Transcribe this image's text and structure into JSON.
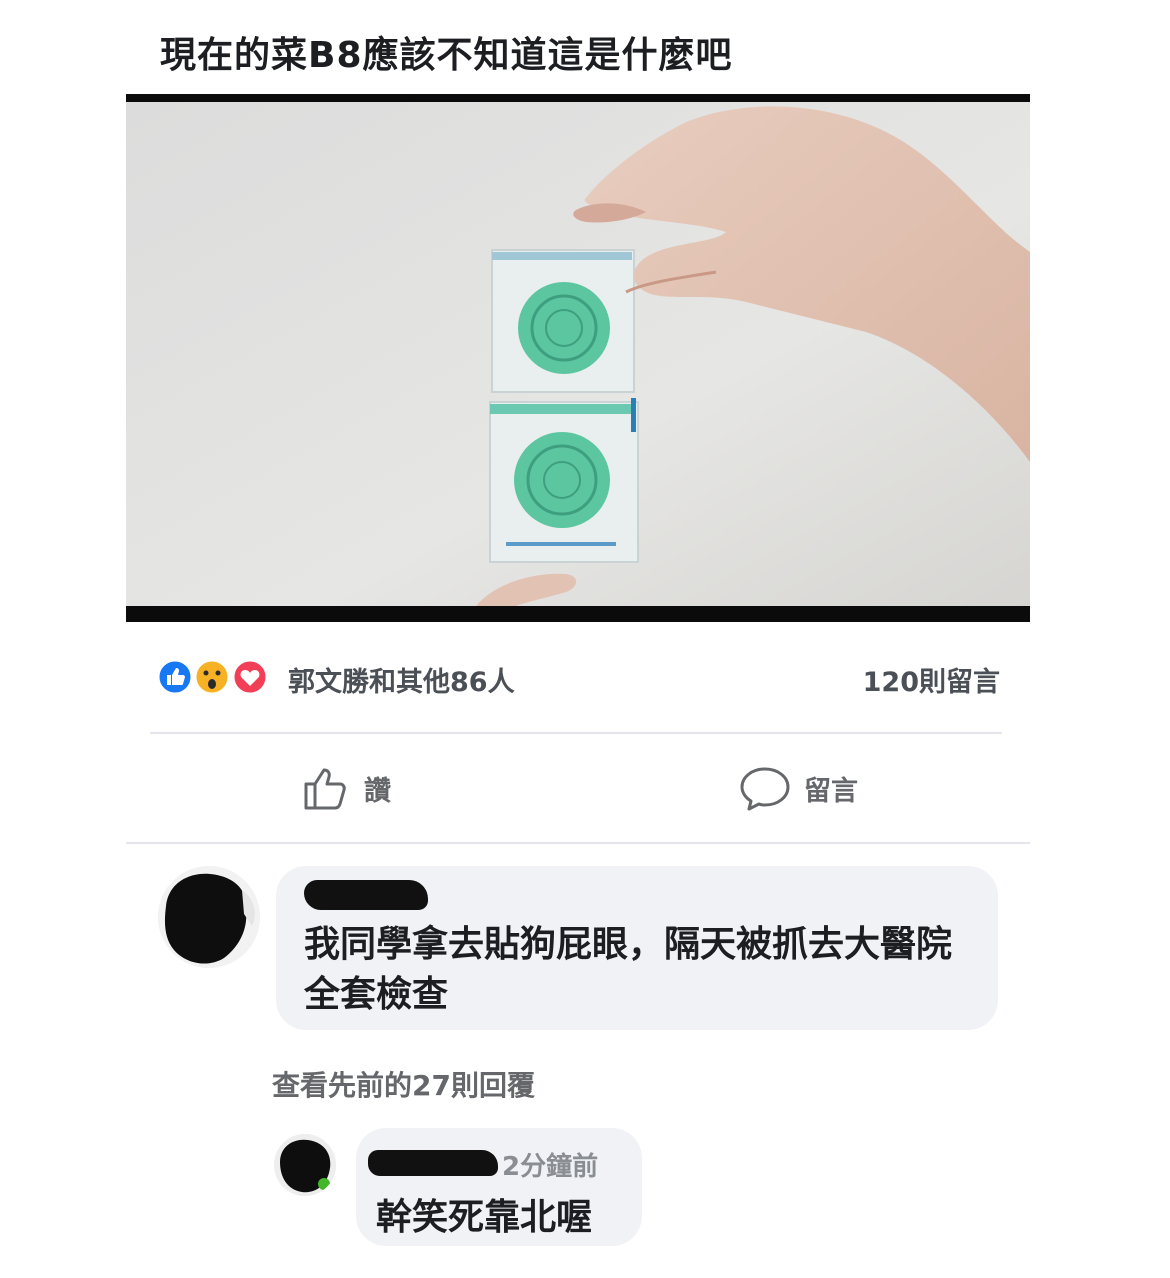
{
  "post": {
    "text": "現在的菜B8應該不知道這是什麼吧"
  },
  "reactions": {
    "icons": [
      "like-icon",
      "wow-icon",
      "love-icon"
    ],
    "summary": "郭文勝和其他86人",
    "comment_count": "120則留言"
  },
  "actions": {
    "like_label": "讚",
    "comment_label": "留言"
  },
  "comments": [
    {
      "text": "我同學拿去貼狗屁眼，隔天被抓去大醫院全套檢查"
    }
  ],
  "view_previous": "查看先前的27則回覆",
  "replies": [
    {
      "time": "2分鐘前",
      "text": "幹笑死靠北喔"
    }
  ],
  "colors": {
    "like_blue": "#1877f2",
    "love_red": "#f33e58",
    "wow_yellow": "#f7b125",
    "bubble_gray": "#f0f2f5",
    "sticker_green": "#5cc6a0"
  }
}
